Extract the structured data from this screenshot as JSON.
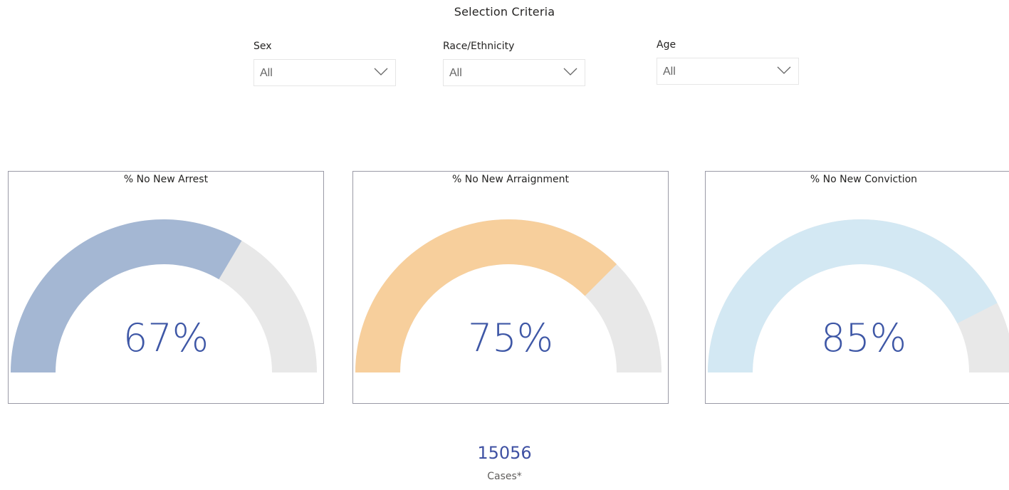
{
  "selection": {
    "title": "Selection Criteria",
    "filters": [
      {
        "label": "Sex",
        "value": "All"
      },
      {
        "label": "Race/Ethnicity",
        "value": "All"
      },
      {
        "label": "Age",
        "value": "All"
      }
    ]
  },
  "gauges": [
    {
      "title": "% No New Arrest",
      "value_text": "67%",
      "value": 0.67,
      "fill_color": "#a4b7d3",
      "track_color": "#e8e8e8"
    },
    {
      "title": "% No New Arraignment",
      "value_text": "75%",
      "value": 0.75,
      "fill_color": "#f7cf9c",
      "track_color": "#e8e8e8"
    },
    {
      "title": "% No New Conviction",
      "value_text": "85%",
      "value": 0.85,
      "fill_color": "#d3e8f3",
      "track_color": "#e8e8e8"
    }
  ],
  "cases": {
    "count": "15056",
    "label": "Cases*"
  },
  "colors": {
    "value_text": "#3e57a6",
    "card_border": "#9a9aa6"
  }
}
